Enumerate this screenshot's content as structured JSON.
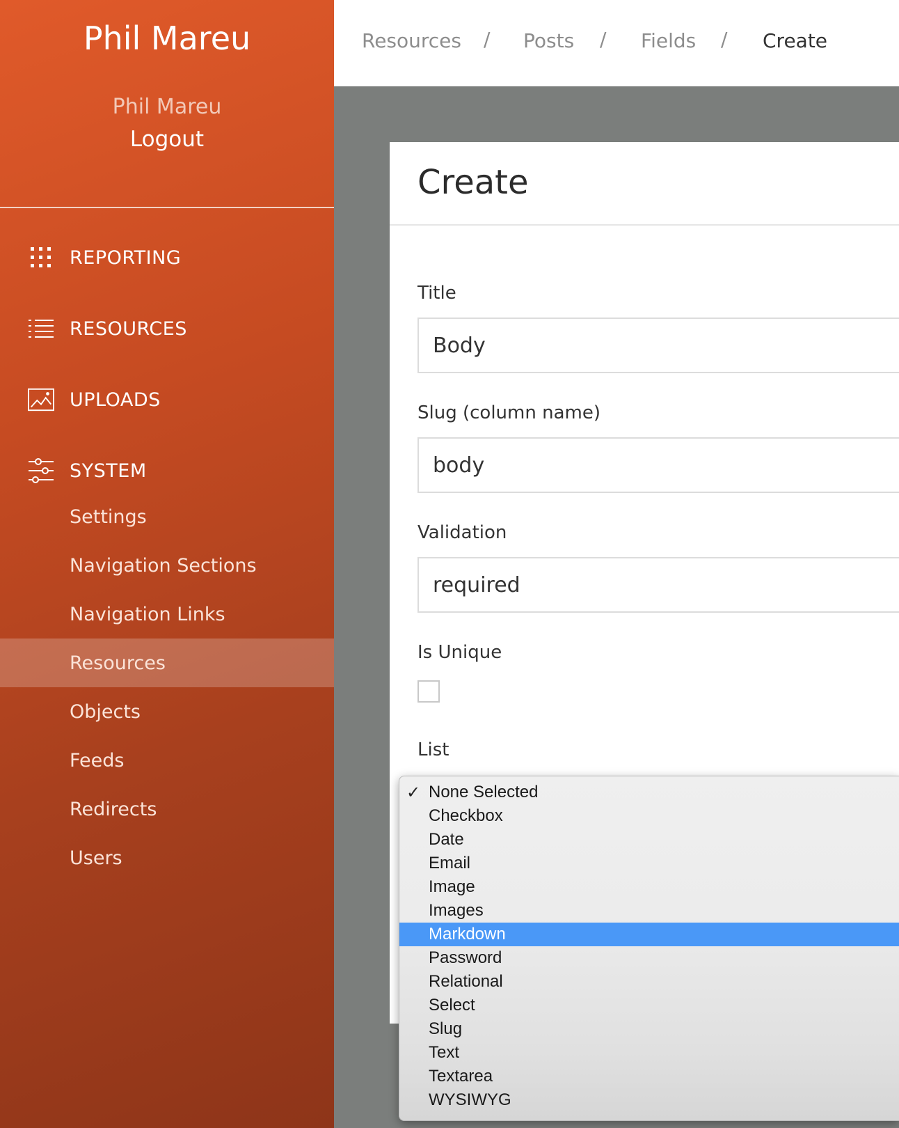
{
  "sidebar": {
    "brand": "Phil Mareu",
    "user_name": "Phil Mareu",
    "logout": "Logout",
    "sections": [
      {
        "label": "REPORTING",
        "icon": "grid-icon"
      },
      {
        "label": "RESOURCES",
        "icon": "list-icon"
      },
      {
        "label": "UPLOADS",
        "icon": "image-icon"
      },
      {
        "label": "SYSTEM",
        "icon": "sliders-icon"
      }
    ],
    "system_items": [
      {
        "label": "Settings"
      },
      {
        "label": "Navigation Sections"
      },
      {
        "label": "Navigation Links"
      },
      {
        "label": "Resources",
        "active": true
      },
      {
        "label": "Objects"
      },
      {
        "label": "Feeds"
      },
      {
        "label": "Redirects"
      },
      {
        "label": "Users"
      }
    ]
  },
  "breadcrumb": {
    "items": [
      "Resources",
      "Posts",
      "Fields",
      "Create"
    ],
    "separator": "/"
  },
  "form": {
    "title": "Create",
    "fields": {
      "title": {
        "label": "Title",
        "value": "Body"
      },
      "slug": {
        "label": "Slug (column name)",
        "value": "body"
      },
      "validation": {
        "label": "Validation",
        "value": "required"
      },
      "unique": {
        "label": "Is Unique",
        "checked": false
      },
      "list": {
        "label": "List"
      }
    }
  },
  "dropdown": {
    "checkmark": "✓",
    "checked": "None Selected",
    "highlighted": "Markdown",
    "options": [
      "None Selected",
      "Checkbox",
      "Date",
      "Email",
      "Image",
      "Images",
      "Markdown",
      "Password",
      "Relational",
      "Select",
      "Slug",
      "Text",
      "Textarea",
      "WYSIWYG"
    ]
  },
  "colors": {
    "sidebar_top": "#e05a2a",
    "sidebar_bottom": "#8e3519",
    "highlight": "#4a98f7",
    "backdrop": "#7b7e7c"
  }
}
